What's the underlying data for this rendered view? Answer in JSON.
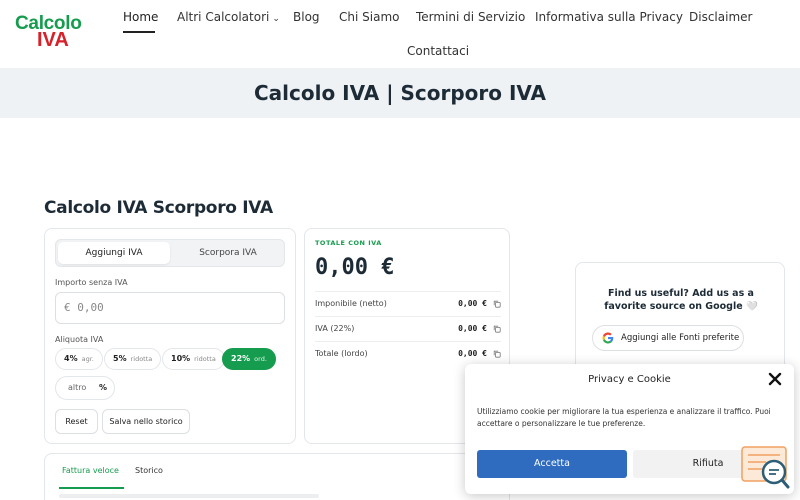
{
  "logo": {
    "line1": "Calcolo",
    "line2": "IVA"
  },
  "nav": {
    "items": [
      {
        "label": "Home"
      },
      {
        "label": "Altri Calcolatori"
      },
      {
        "label": "Blog"
      },
      {
        "label": "Chi Siamo"
      },
      {
        "label": "Termini di Servizio"
      },
      {
        "label": "Informativa sulla Privacy"
      },
      {
        "label": "Disclaimer"
      },
      {
        "label": "Contattaci"
      }
    ],
    "dropdown_caret": "⌄"
  },
  "banner": {
    "title": "Calcolo IVA | Scorporo IVA"
  },
  "section": {
    "title": "Calcolo IVA Scorporo IVA"
  },
  "calculator": {
    "modes": [
      "Aggiungi IVA",
      "Scorpora IVA"
    ],
    "amount_label": "Importo senza IVA",
    "amount_placeholder": "€ 0,00",
    "rate_label": "Aliquota IVA",
    "rates": [
      {
        "value": "4%",
        "note": "agr."
      },
      {
        "value": "5%",
        "note": "ridotta"
      },
      {
        "value": "10%",
        "note": "ridotta"
      },
      {
        "value": "22%",
        "note": "ord."
      }
    ],
    "selected_rate": "22%",
    "other_label": "altro",
    "other_suffix": "%",
    "reset_label": "Reset",
    "save_label": "Salva nello storico"
  },
  "results": {
    "title": "TOTALE CON IVA",
    "total": "0,00 €",
    "rows": [
      {
        "label": "Imponibile (netto)",
        "value": "0,00 €"
      },
      {
        "label": "IVA (22%)",
        "value": "0,00 €"
      },
      {
        "label": "Totale (lordo)",
        "value": "0,00 €"
      }
    ]
  },
  "bottom_tabs": [
    "Fattura veloce",
    "Storico"
  ],
  "google": {
    "text": "Find us useful? Add us as a favorite source on Google 🤍",
    "button": "Aggiungi alle Fonti preferite"
  },
  "cookie": {
    "title": "Privacy e Cookie",
    "body": "Utilizziamo cookie per migliorare la tua esperienza e analizzare il traffico. Puoi accettare o personalizzare le tue preferenze.",
    "accept": "Accetta",
    "reject": "Rifiuta"
  },
  "colors": {
    "brand_green": "#169c4e",
    "brand_red": "#d6202a",
    "accept_blue": "#2f6cbf",
    "banner_bg": "#eef2f5"
  },
  "icons": [
    "copy-icon",
    "google-logo-icon",
    "close-icon",
    "cookie-settings-icon"
  ]
}
